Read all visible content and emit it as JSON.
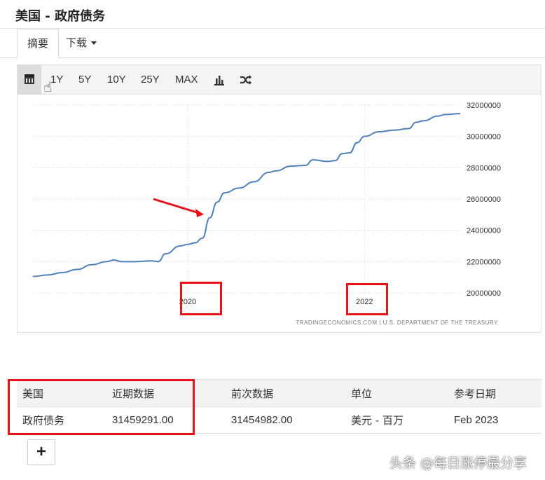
{
  "header": {
    "title": "美国 - 政府债务"
  },
  "tabs": [
    {
      "label": "摘要"
    },
    {
      "label": "下载"
    }
  ],
  "toolbar": {
    "ranges": [
      "1Y",
      "5Y",
      "10Y",
      "25Y",
      "MAX"
    ],
    "icons": [
      "calendar-icon",
      "bar-chart-icon",
      "shuffle-icon"
    ]
  },
  "chart_data": {
    "type": "line",
    "x_ticks": [
      "2020",
      "2022"
    ],
    "y_ticks": [
      "32000000",
      "30000000",
      "28000000",
      "26000000",
      "24000000",
      "22000000",
      "20000000"
    ],
    "ylim": [
      20000000,
      32000000
    ],
    "xlim": [
      "2018-04",
      "2023-02"
    ],
    "grid": true,
    "source": "TRADINGECONOMICS.COM  |  U.S. DEPARTMENT OF THE TREASURY",
    "series": [
      {
        "color": "#4f81b8",
        "points": [
          [
            "2018-04",
            21050000
          ],
          [
            "2018-06",
            21150000
          ],
          [
            "2018-08",
            21300000
          ],
          [
            "2018-10",
            21500000
          ],
          [
            "2018-12",
            21800000
          ],
          [
            "2019-02",
            22000000
          ],
          [
            "2019-03",
            22100000
          ],
          [
            "2019-04",
            22000000
          ],
          [
            "2019-06",
            22000000
          ],
          [
            "2019-08",
            22050000
          ],
          [
            "2019-09",
            22000000
          ],
          [
            "2019-10",
            22500000
          ],
          [
            "2019-12",
            23000000
          ],
          [
            "2020-01",
            23100000
          ],
          [
            "2020-02",
            23200000
          ],
          [
            "2020-03",
            23500000
          ],
          [
            "2020-04",
            24800000
          ],
          [
            "2020-05",
            25800000
          ],
          [
            "2020-06",
            26400000
          ],
          [
            "2020-08",
            26700000
          ],
          [
            "2020-10",
            27100000
          ],
          [
            "2020-12",
            27700000
          ],
          [
            "2021-01",
            27800000
          ],
          [
            "2021-03",
            28100000
          ],
          [
            "2021-05",
            28150000
          ],
          [
            "2021-06",
            28500000
          ],
          [
            "2021-08",
            28400000
          ],
          [
            "2021-09",
            28450000
          ],
          [
            "2021-10",
            28900000
          ],
          [
            "2021-11",
            28950000
          ],
          [
            "2021-12",
            29600000
          ],
          [
            "2022-01",
            30000000
          ],
          [
            "2022-03",
            30300000
          ],
          [
            "2022-05",
            30400000
          ],
          [
            "2022-07",
            30500000
          ],
          [
            "2022-08",
            30900000
          ],
          [
            "2022-09",
            31000000
          ],
          [
            "2022-11",
            31300000
          ],
          [
            "2022-12",
            31400000
          ],
          [
            "2023-02",
            31459291
          ]
        ]
      }
    ]
  },
  "table": {
    "headers": [
      "美国",
      "近期数据",
      "前次数据",
      "单位",
      "参考日期"
    ],
    "rows": [
      [
        "政府债务",
        "31459291.00",
        "31454982.00",
        "美元 - 百万",
        "Feb 2023"
      ]
    ]
  },
  "expand_button": {
    "label": "+"
  },
  "watermark": "头条 @每日涨停最分享",
  "colors": {
    "annotation": "#e8121b",
    "line": "#4f81b8"
  }
}
